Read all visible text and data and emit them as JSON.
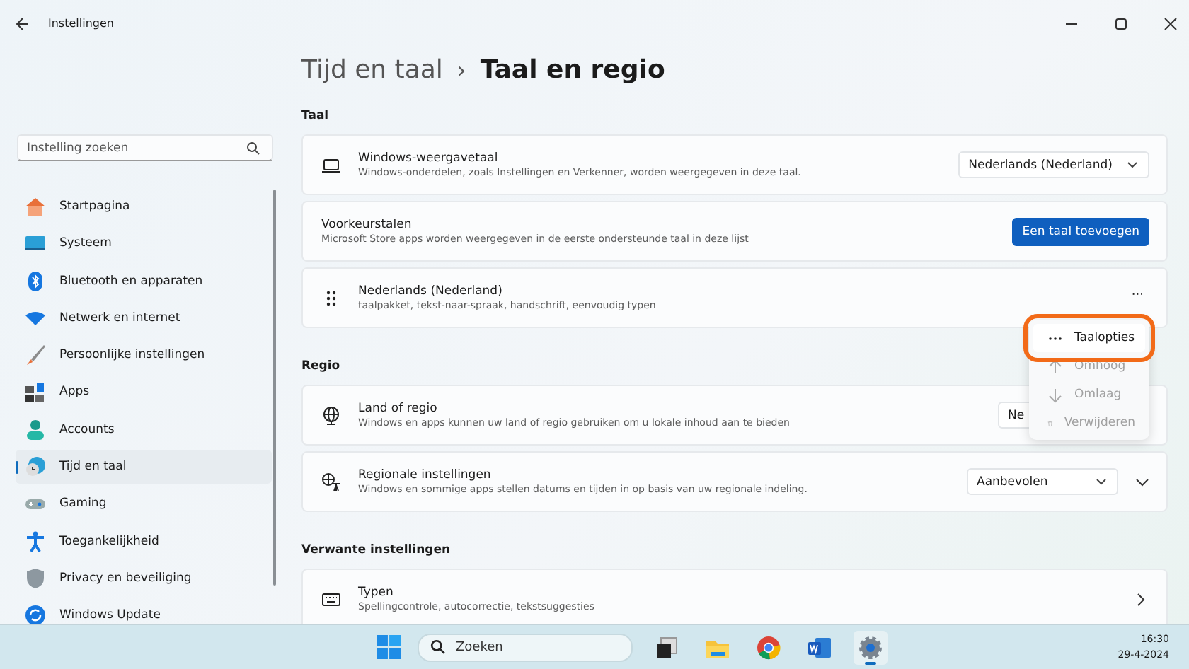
{
  "window": {
    "title": "Instellingen"
  },
  "search": {
    "placeholder": "Instelling zoeken"
  },
  "sidebar": {
    "items": [
      {
        "label": "Startpagina",
        "selected": false
      },
      {
        "label": "Systeem",
        "selected": false
      },
      {
        "label": "Bluetooth en apparaten",
        "selected": false
      },
      {
        "label": "Netwerk en internet",
        "selected": false
      },
      {
        "label": "Persoonlijke instellingen",
        "selected": false
      },
      {
        "label": "Apps",
        "selected": false
      },
      {
        "label": "Accounts",
        "selected": false
      },
      {
        "label": "Tijd en taal",
        "selected": true
      },
      {
        "label": "Gaming",
        "selected": false
      },
      {
        "label": "Toegankelijkheid",
        "selected": false
      },
      {
        "label": "Privacy en beveiliging",
        "selected": false
      },
      {
        "label": "Windows Update",
        "selected": false
      }
    ]
  },
  "breadcrumb": {
    "parent": "Tijd en taal",
    "separator": "›",
    "current": "Taal en regio"
  },
  "sections": [
    {
      "heading": "Taal",
      "cards": [
        {
          "kind": "dropdown",
          "title": "Windows-weergavetaal",
          "subtitle": "Windows-onderdelen, zoals Instellingen en Verkenner, worden weergegeven in deze taal.",
          "value": "Nederlands (Nederland)"
        },
        {
          "kind": "button",
          "title": "Voorkeurstalen",
          "subtitle": "Microsoft Store apps worden weergegeven in de eerste ondersteunde taal in deze lijst",
          "value": "Een taal toevoegen"
        },
        {
          "kind": "language",
          "title": "Nederlands (Nederland)",
          "subtitle": "taalpakket, tekst-naar-spraak, handschrift, eenvoudig typen",
          "value": "···"
        }
      ]
    },
    {
      "heading": "Regio",
      "cards": [
        {
          "kind": "dropdown",
          "title": "Land of regio",
          "subtitle": "Windows en apps kunnen uw land of regio gebruiken om u lokale inhoud aan te bieden",
          "value": "Ne"
        },
        {
          "kind": "dropdown-expand",
          "title": "Regionale instellingen",
          "subtitle": "Windows en sommige apps stellen datums en tijden in op basis van uw regionale indeling.",
          "value": "Aanbevolen"
        }
      ]
    },
    {
      "heading": "Verwante instellingen",
      "cards": [
        {
          "kind": "link",
          "title": "Typen",
          "subtitle": "Spellingcontrole, autocorrectie, tekstsuggesties"
        }
      ]
    }
  ],
  "context_menu": {
    "items": [
      {
        "label": "Taalopties",
        "disabled": false,
        "highlighted": true
      },
      {
        "label": "Omhoog",
        "disabled": true,
        "highlighted": false
      },
      {
        "label": "Omlaag",
        "disabled": true,
        "highlighted": false
      },
      {
        "label": "Verwijderen",
        "disabled": true,
        "highlighted": false
      }
    ]
  },
  "taskbar": {
    "search_placeholder": "Zoeken",
    "apps": [
      {
        "selected": false
      },
      {
        "selected": false
      },
      {
        "selected": false
      },
      {
        "selected": false
      },
      {
        "selected": true
      }
    ],
    "time": "16:30",
    "date": "29-4-2024"
  }
}
